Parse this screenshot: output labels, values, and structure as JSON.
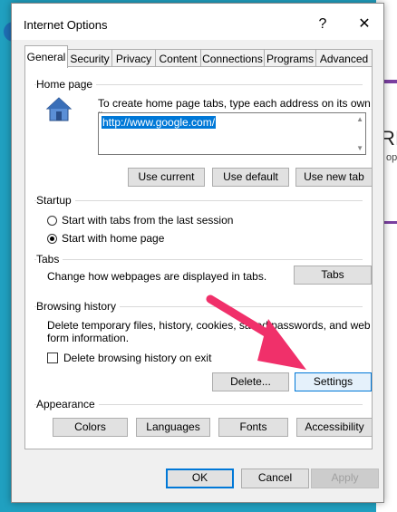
{
  "window": {
    "title": "Internet Options",
    "help_glyph": "?",
    "close_glyph": "✕"
  },
  "tabs": [
    {
      "label": "General"
    },
    {
      "label": "Security"
    },
    {
      "label": "Privacy"
    },
    {
      "label": "Content"
    },
    {
      "label": "Connections"
    },
    {
      "label": "Programs"
    },
    {
      "label": "Advanced"
    }
  ],
  "home_page": {
    "title": "Home page",
    "description": "To create home page tabs, type each address on its own line.",
    "url": "http://www.google.com/",
    "use_current": "Use current",
    "use_default": "Use default",
    "use_new_tab": "Use new tab"
  },
  "startup": {
    "title": "Startup",
    "option1": "Start with tabs from the last session",
    "option2": "Start with home page",
    "selected": "Start with home page"
  },
  "tabs_section": {
    "title": "Tabs",
    "description": "Change how webpages are displayed in tabs.",
    "button": "Tabs"
  },
  "browsing_history": {
    "title": "Browsing history",
    "description_line1": "Delete temporary files, history, cookies, saved passwords, and web",
    "description_line2": "form information.",
    "checkbox_label": "Delete browsing history on exit",
    "checkbox_checked": false,
    "delete_button": "Delete...",
    "settings_button": "Settings"
  },
  "appearance": {
    "title": "Appearance",
    "colors": "Colors",
    "languages": "Languages",
    "fonts": "Fonts",
    "accessibility": "Accessibility"
  },
  "footer": {
    "ok": "OK",
    "cancel": "Cancel",
    "apply": "Apply"
  },
  "background": {
    "partial_text": "RI",
    "partial_text2": "op"
  },
  "colors": {
    "accent": "#0078d7",
    "annotation_arrow": "#f0306a"
  }
}
